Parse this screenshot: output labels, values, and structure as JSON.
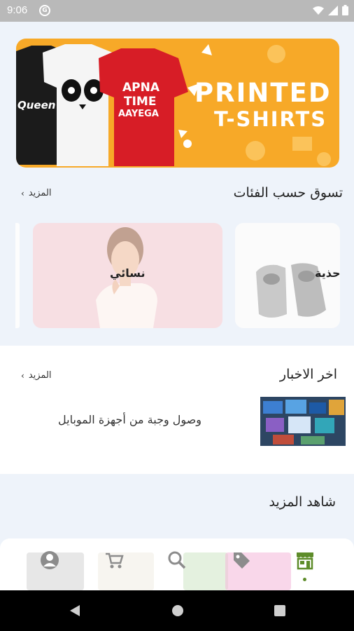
{
  "status_bar": {
    "time": "9:06"
  },
  "banner": {
    "line1": "PRINTED",
    "line2": "T-SHIRTS",
    "shirt_texts": [
      "Queen",
      "APNA",
      "TIME",
      "AAYEGA"
    ]
  },
  "categories": {
    "title": "تسوق حسب الفئات",
    "more": "المزيد",
    "items": [
      {
        "label": "نسائي"
      },
      {
        "label": "أحذية"
      }
    ]
  },
  "news": {
    "title": "اخر الاخبار",
    "more": "المزيد",
    "items": [
      {
        "text": "وصول وجبة من أجهزة الموبايل"
      }
    ]
  },
  "more_section": {
    "title": "شاهد المزيد"
  },
  "bottom_nav": {
    "items": [
      {
        "icon": "profile-icon"
      },
      {
        "icon": "cart-icon"
      },
      {
        "icon": "search-icon"
      },
      {
        "icon": "tag-icon"
      },
      {
        "icon": "store-icon",
        "active": true
      }
    ],
    "accent": "#5e8c2a"
  },
  "colors": {
    "banner": "#f7a928",
    "page_bg": "#eef3fa",
    "accent": "#5e8c2a"
  }
}
